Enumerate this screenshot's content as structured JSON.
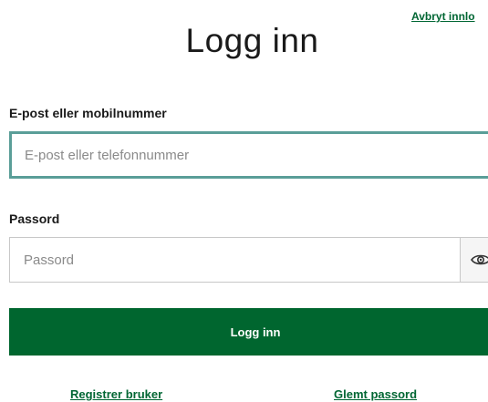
{
  "header": {
    "cancel_label": "Avbryt innlo"
  },
  "title": "Logg inn",
  "email": {
    "label": "E-post eller mobilnummer",
    "placeholder": "E-post eller telefonnummer",
    "value": ""
  },
  "password": {
    "label": "Passord",
    "placeholder": "Passord",
    "value": "",
    "toggle_icon": "eye-icon"
  },
  "submit_label": "Logg inn",
  "links": {
    "register": "Registrer bruker",
    "forgot": "Glemt passord"
  },
  "colors": {
    "accent": "#00662f",
    "focus_border": "#5a9e98"
  }
}
